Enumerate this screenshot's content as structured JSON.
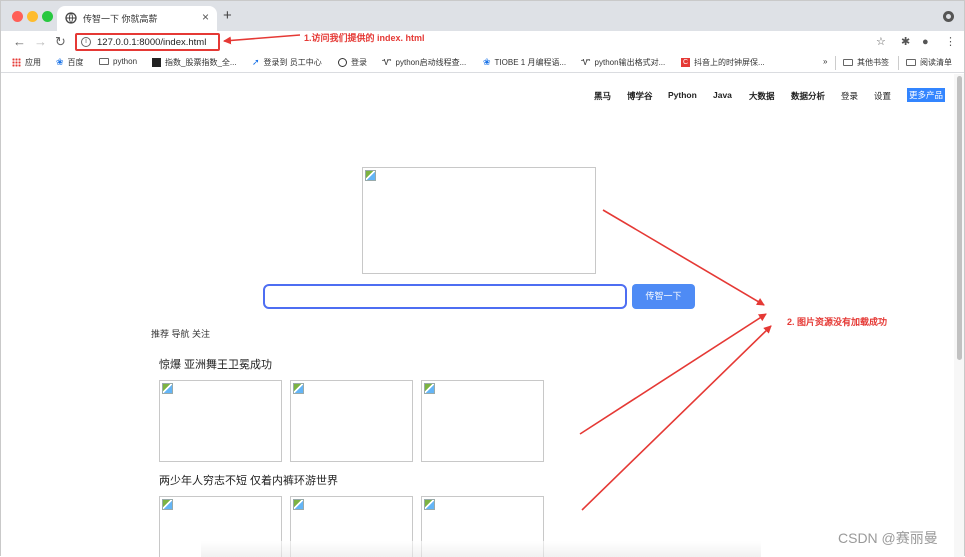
{
  "browser": {
    "tab_title": "传智一下 你就高薪",
    "new_tab_symbol": "+",
    "close_symbol": "×",
    "url": "127.0.0.1:8000/index.html",
    "bookmarks": [
      {
        "label": "应用",
        "icon": "apps-grid-icon"
      },
      {
        "label": "百度",
        "icon": "baidu-paw-icon"
      },
      {
        "label": "python",
        "icon": "folder-icon"
      },
      {
        "label": "指数_股票指数_全...",
        "icon": "stock-index-icon"
      },
      {
        "label": "登录到 员工中心",
        "icon": "login-icon"
      },
      {
        "label": "登录",
        "icon": "globe-icon"
      },
      {
        "label": "python启动线程查...",
        "icon": "csdn-icon"
      },
      {
        "label": "TIOBE 1 月编程语...",
        "icon": "baidu-paw-icon"
      },
      {
        "label": "python输出格式对...",
        "icon": "csdn-icon"
      },
      {
        "label": "抖音上的时钟屏保...",
        "icon": "red-c-icon"
      }
    ],
    "bookmarks_overflow": "»",
    "other_bookmarks": "其他书签",
    "reading_list": "阅读清单"
  },
  "annotations": {
    "arrow1_text": "1.访问我们提供的 index. html",
    "arrow2_text": "2. 图片资源没有加载成功"
  },
  "page": {
    "topnav": [
      "黑马",
      "博学谷",
      "Python",
      "Java",
      "大数据",
      "数据分析",
      "登录",
      "设置"
    ],
    "more_products": "更多产品",
    "search_button": "传智一下",
    "search_value": "",
    "recommend_nav": "推荐 导航 关注",
    "news": [
      {
        "title": "惊爆 亚洲舞王卫冕成功"
      },
      {
        "title": "两少年人穷志不短 仅着内裤环游世界"
      }
    ]
  },
  "watermark": "CSDN @赛丽曼",
  "colors": {
    "annotation_red": "#e53935",
    "search_blue": "#4e6ef2",
    "button_blue": "#4e8bf5",
    "more_btn_blue": "#3385ff"
  }
}
